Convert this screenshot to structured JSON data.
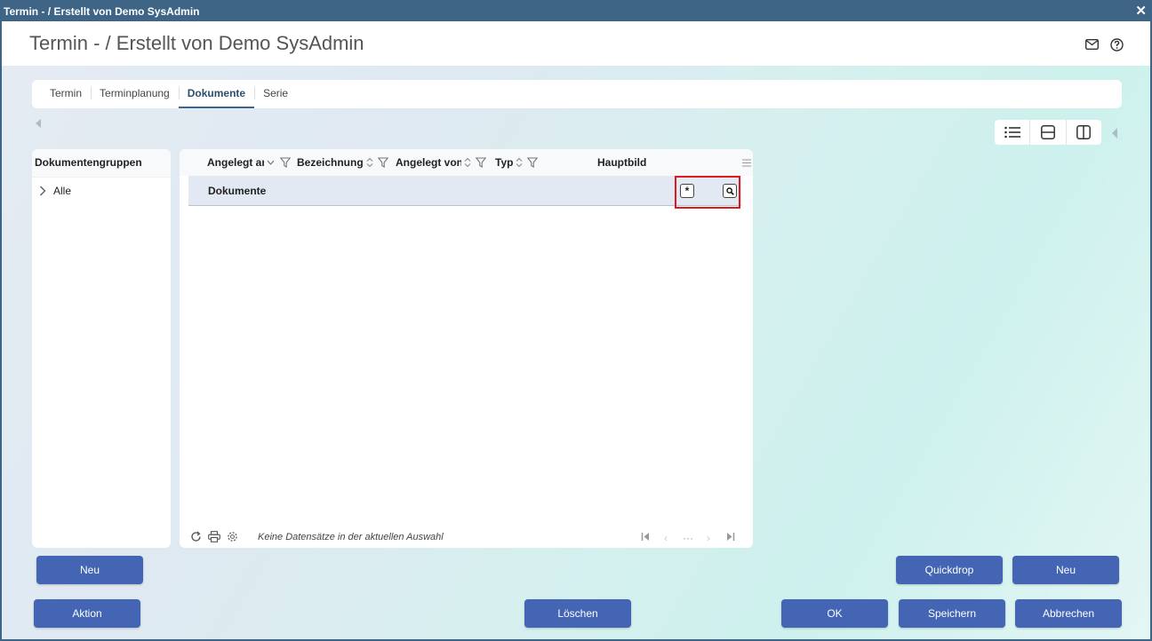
{
  "window": {
    "title": "Termin - / Erstellt von Demo SysAdmin",
    "close_label": "✕"
  },
  "header": {
    "title": "Termin - / Erstellt von Demo SysAdmin"
  },
  "tabs": [
    {
      "label": "Termin"
    },
    {
      "label": "Terminplanung"
    },
    {
      "label": "Dokumente",
      "active": true
    },
    {
      "label": "Serie"
    }
  ],
  "left_panel": {
    "title": "Dokumentengruppen",
    "items": [
      {
        "label": "Alle"
      }
    ]
  },
  "grid": {
    "columns": [
      {
        "label": "Angelegt am"
      },
      {
        "label": "Bezeichnung"
      },
      {
        "label": "Angelegt von"
      },
      {
        "label": "Typ"
      },
      {
        "label": "Hauptbild"
      }
    ],
    "group_row": {
      "label": "Dokumente",
      "new_button": "*"
    },
    "status": "Keine Datensätze in der aktuellen Auswahl",
    "pager": {
      "first": "|◀",
      "prev": "‹",
      "dots": "···",
      "next": "›",
      "last": "▶|"
    }
  },
  "buttons": {
    "neu_left": "Neu",
    "quickdrop": "Quickdrop",
    "neu_right": "Neu",
    "aktion": "Aktion",
    "loeschen": "Löschen",
    "ok": "OK",
    "speichern": "Speichern",
    "abbrechen": "Abbrechen"
  },
  "colors": {
    "titlebar": "#3e6486",
    "button": "#4365b4",
    "highlight": "#e0191f"
  }
}
